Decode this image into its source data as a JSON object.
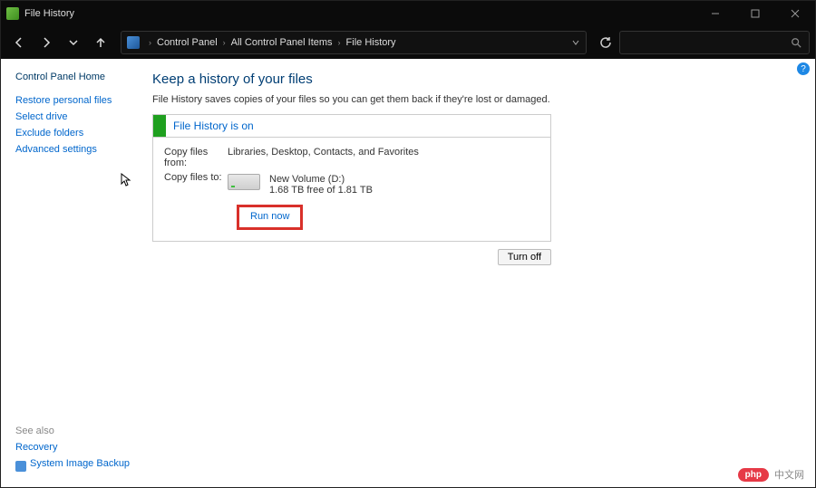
{
  "window": {
    "title": "File History"
  },
  "winbtns": {
    "min": "minimize",
    "max": "maximize",
    "close": "close"
  },
  "breadcrumbs": {
    "b1": "Control Panel",
    "b2": "All Control Panel Items",
    "b3": "File History"
  },
  "sidebar": {
    "home": "Control Panel Home",
    "links": {
      "restore": "Restore personal files",
      "select": "Select drive",
      "exclude": "Exclude folders",
      "advanced": "Advanced settings"
    },
    "seealso_label": "See also",
    "seealso": {
      "recovery": "Recovery",
      "backup": "System Image Backup"
    }
  },
  "main": {
    "heading": "Keep a history of your files",
    "subtext": "File History saves copies of your files so you can get them back if they're lost or damaged.",
    "status_title": "File History is on",
    "copy_from_label": "Copy files from:",
    "copy_from_value": "Libraries, Desktop, Contacts, and Favorites",
    "copy_to_label": "Copy files to:",
    "drive_name": "New Volume (D:)",
    "drive_free": "1.68 TB free of 1.81 TB",
    "run_now": "Run now",
    "turn_off": "Turn off"
  },
  "watermark": {
    "pill": "php",
    "text": "中文网"
  }
}
